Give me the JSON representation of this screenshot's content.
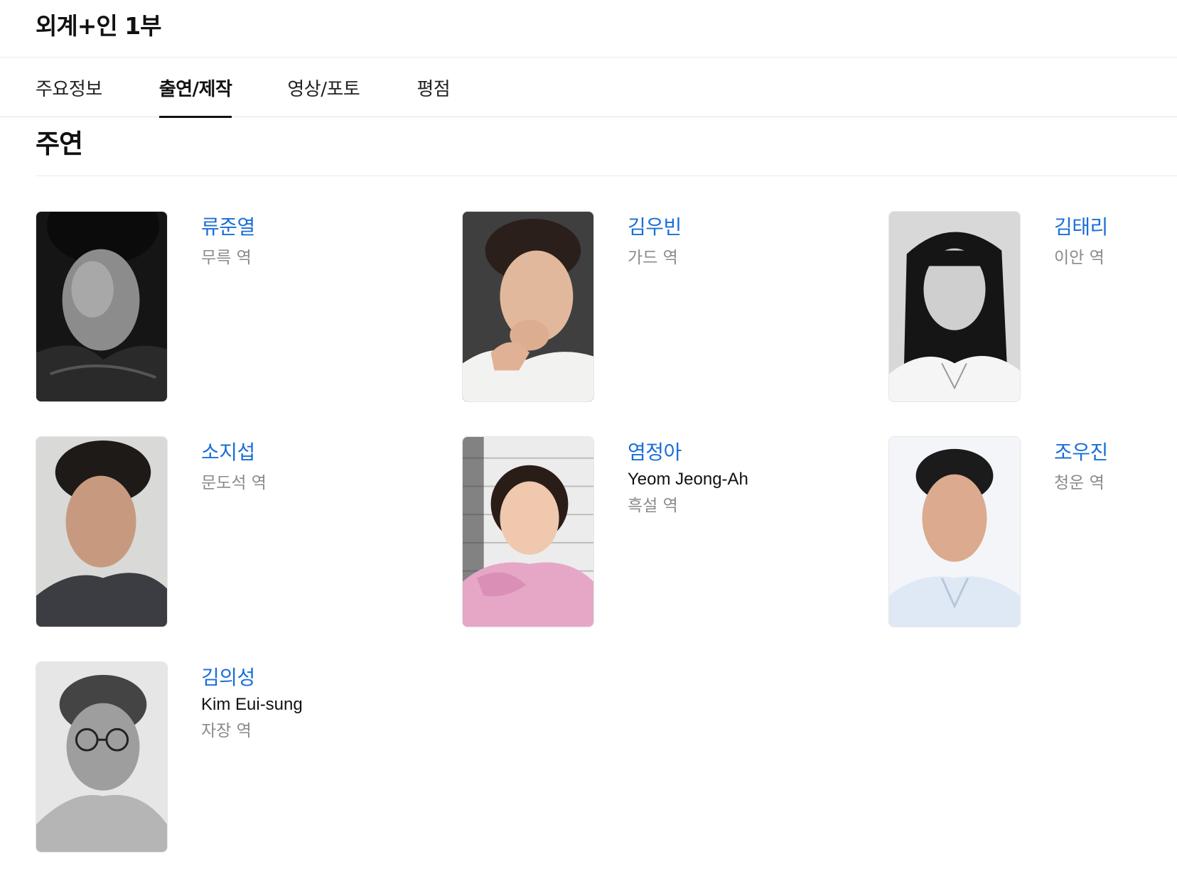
{
  "header": {
    "title": "외계+인 1부"
  },
  "tabs": [
    {
      "label": "주요정보"
    },
    {
      "label": "출연/제작"
    },
    {
      "label": "영상/포토"
    },
    {
      "label": "평점"
    }
  ],
  "active_tab": "출연/제작",
  "section": {
    "title": "주연"
  },
  "cast": [
    {
      "name": "류준열",
      "role": "무륵 역"
    },
    {
      "name": "김우빈",
      "role": "가드 역"
    },
    {
      "name": "김태리",
      "role": "이안 역"
    },
    {
      "name": "소지섭",
      "role": "문도석 역"
    },
    {
      "name": "염정아",
      "english_name": "Yeom Jeong-Ah",
      "role": "흑설 역"
    },
    {
      "name": "조우진",
      "role": "청운 역"
    },
    {
      "name": "김의성",
      "english_name": "Kim Eui-sung",
      "role": "자장 역"
    }
  ]
}
